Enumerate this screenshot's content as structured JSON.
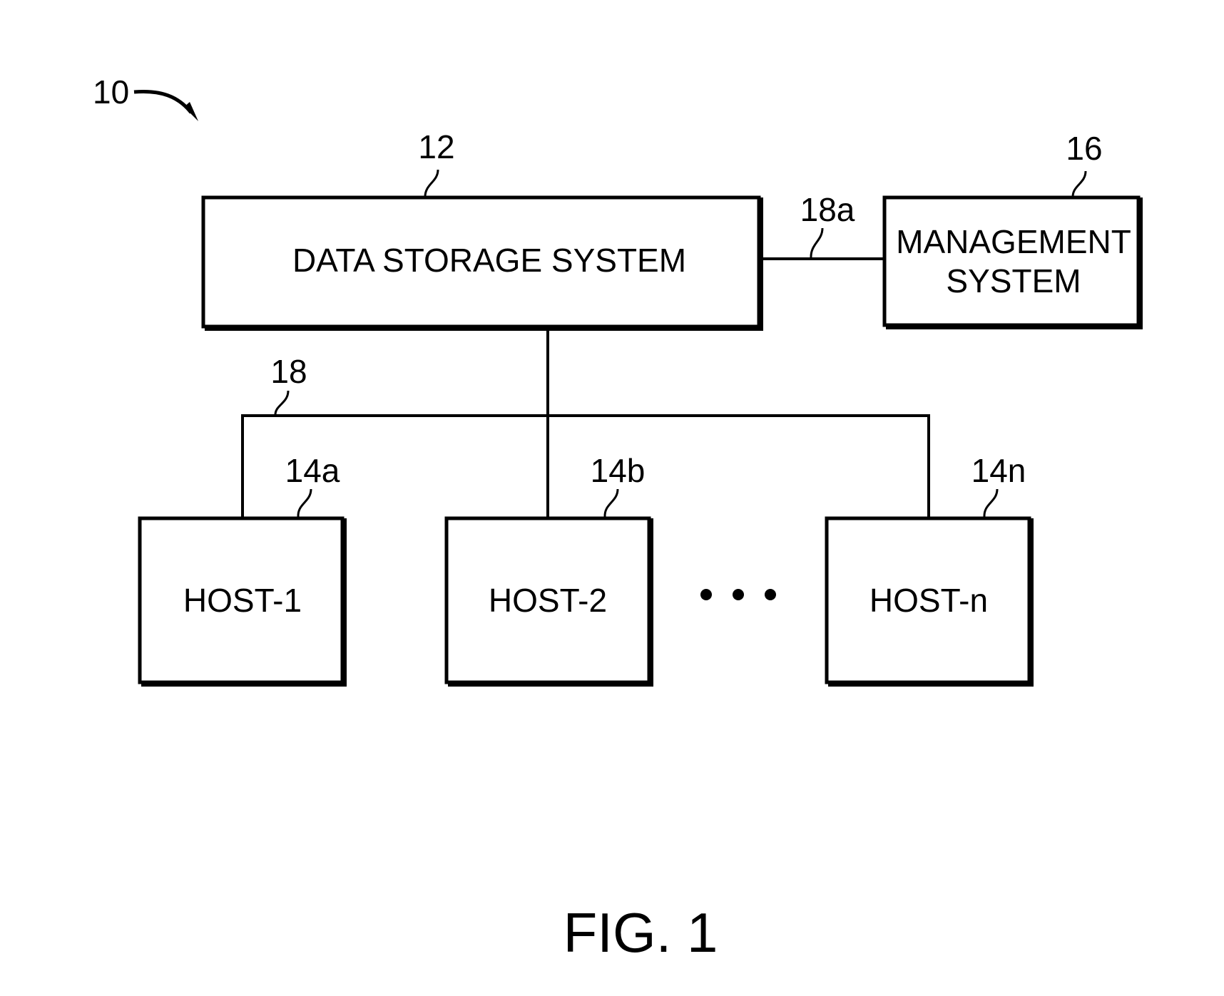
{
  "figure": {
    "caption": "FIG. 1",
    "system_ref": "10"
  },
  "data_storage_system": {
    "ref": "12",
    "label": "DATA STORAGE SYSTEM"
  },
  "management_system": {
    "ref": "16",
    "label_line1": "MANAGEMENT",
    "label_line2": "SYSTEM"
  },
  "connections": {
    "management_link_ref": "18a",
    "host_bus_ref": "18"
  },
  "hosts": [
    {
      "ref": "14a",
      "label": "HOST-1"
    },
    {
      "ref": "14b",
      "label": "HOST-2"
    },
    {
      "ref": "14n",
      "label": "HOST-n"
    }
  ],
  "ellipsis": "• • •"
}
